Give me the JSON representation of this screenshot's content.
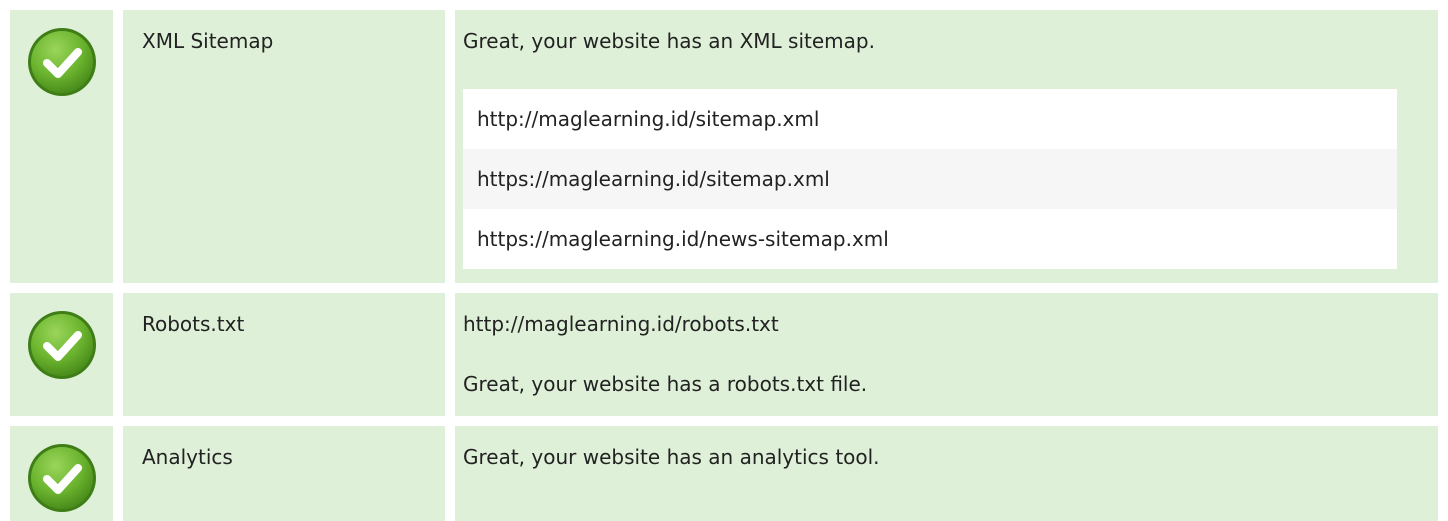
{
  "rows": {
    "sitemap": {
      "name": "XML Sitemap",
      "message": "Great, your website has an XML sitemap.",
      "urls": [
        "http://maglearning.id/sitemap.xml",
        "https://maglearning.id/sitemap.xml",
        "https://maglearning.id/news-sitemap.xml"
      ],
      "icon": "check-circle-icon"
    },
    "robots": {
      "name": "Robots.txt",
      "url": "http://maglearning.id/robots.txt",
      "message": "Great, your website has a robots.txt file.",
      "icon": "check-circle-icon"
    },
    "analytics": {
      "name": "Analytics",
      "message": "Great, your website has an analytics tool.",
      "icon": "check-circle-icon"
    }
  },
  "colors": {
    "row_bg": "#dff0d8",
    "check_green": "#6cb52f",
    "check_green_dark": "#4a8e1c"
  }
}
